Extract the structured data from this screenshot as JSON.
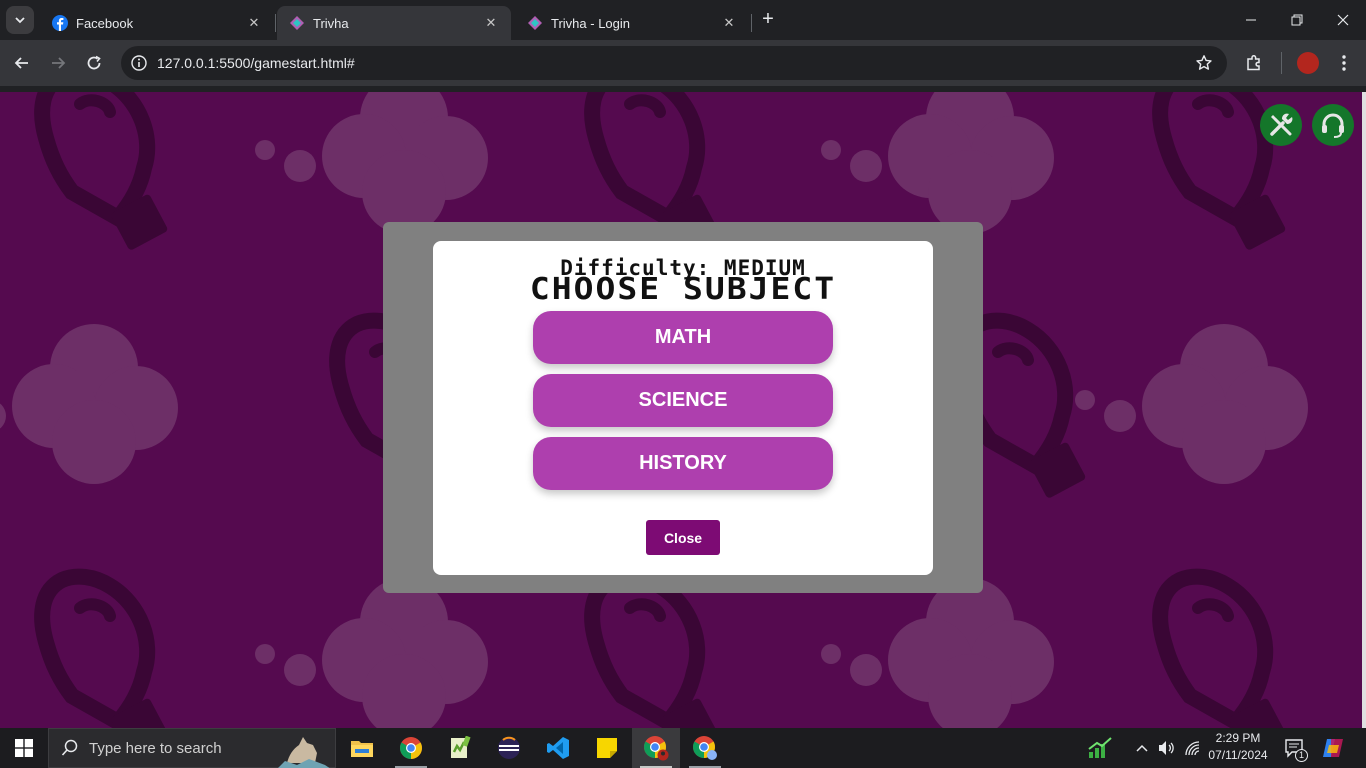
{
  "browser": {
    "tabs": [
      {
        "title": "Facebook",
        "favicon": "facebook-icon",
        "active": false
      },
      {
        "title": "Trivha",
        "favicon": "trivha-icon",
        "active": true
      },
      {
        "title": "Trivha - Login",
        "favicon": "trivha-icon",
        "active": false
      }
    ],
    "url": "127.0.0.1:5500/gamestart.html#"
  },
  "page": {
    "background_color": "#550a4f",
    "corner_buttons": [
      {
        "icon": "tools-icon",
        "color": "#14762a"
      },
      {
        "icon": "headset-icon",
        "color": "#14762a"
      }
    ]
  },
  "modal": {
    "difficulty": "Difficulty: MEDIUM",
    "heading": "CHOOSE SUBJECT",
    "subjects": [
      "MATH",
      "SCIENCE",
      "HISTORY"
    ],
    "close_label": "Close",
    "button_color": "#ae3fae",
    "close_color": "#7d0b74"
  },
  "taskbar": {
    "search_placeholder": "Type here to search",
    "apps": [
      "file-explorer-icon",
      "chrome-icon",
      "notepad-plus-icon",
      "eclipse-icon",
      "vscode-icon",
      "sticky-notes-icon",
      "chrome-active-icon",
      "chrome-profile-icon"
    ],
    "time": "2:29 PM",
    "date": "07/11/2024",
    "notification_count": "1"
  }
}
